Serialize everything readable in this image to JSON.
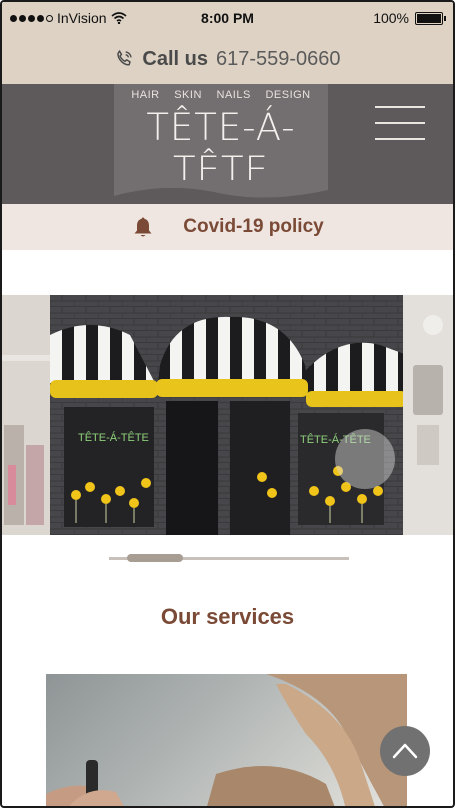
{
  "status_bar": {
    "carrier": "InVision",
    "time": "8:00 PM",
    "battery": "100%",
    "battery_level": 1.0
  },
  "call_bar": {
    "label": "Call us",
    "phone": "617-559-0660",
    "icon": "phone-icon"
  },
  "header": {
    "logo_tags": [
      "HAIR",
      "SKIN",
      "NAILS",
      "DESIGN"
    ],
    "logo_name": "TÊTE-Á-TÊTE",
    "menu_icon": "hamburger-menu-icon"
  },
  "covid_banner": {
    "label": "Covid-19 policy",
    "icon": "bell-icon"
  },
  "carousel": {
    "storefront_sign": "TÊTE-Á-TÊTE",
    "next_icon": "carousel-next-button",
    "position": 0.1
  },
  "services": {
    "title": "Our services"
  },
  "scroll_top_icon": "chevron-up-icon",
  "colors": {
    "header_bg": "#5e5a5c",
    "top_bar_bg": "#ddd2c4",
    "accent_brown": "#7a4a36",
    "covid_bg": "#efe5e1"
  }
}
